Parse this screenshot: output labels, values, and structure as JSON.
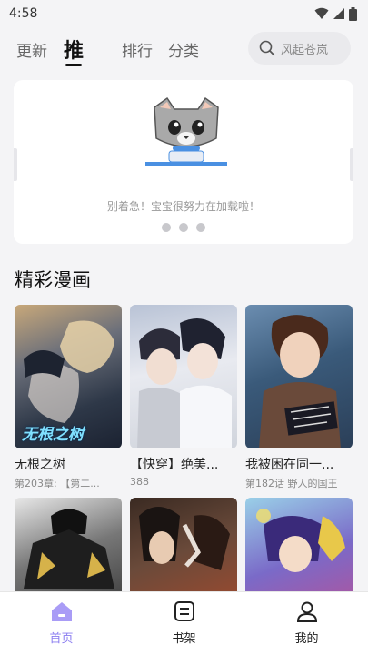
{
  "status": {
    "time": "4:58"
  },
  "tabs": [
    {
      "label": "更新"
    },
    {
      "label": "推"
    },
    {
      "label": "排行"
    },
    {
      "label": "分类"
    }
  ],
  "search": {
    "placeholder": "风起苍岚"
  },
  "banner": {
    "message": "别着急！宝宝很努力在加载啦！"
  },
  "section": {
    "title": "精彩漫画"
  },
  "comics": [
    {
      "title": "无根之树",
      "subtitle": "第203章: 【第二...",
      "cover_text": "无根之树"
    },
    {
      "title": "【快穿】绝美...",
      "subtitle": "388"
    },
    {
      "title": "我被困在同一...",
      "subtitle": "第182话 野人的国王"
    },
    {
      "title": "",
      "subtitle": ""
    },
    {
      "title": "",
      "subtitle": ""
    },
    {
      "title": "",
      "subtitle": ""
    }
  ],
  "bottom_nav": [
    {
      "label": "首页"
    },
    {
      "label": "书架"
    },
    {
      "label": "我的"
    }
  ],
  "colors": {
    "accent": "#8a7cf0",
    "background": "#f4f4f6"
  }
}
